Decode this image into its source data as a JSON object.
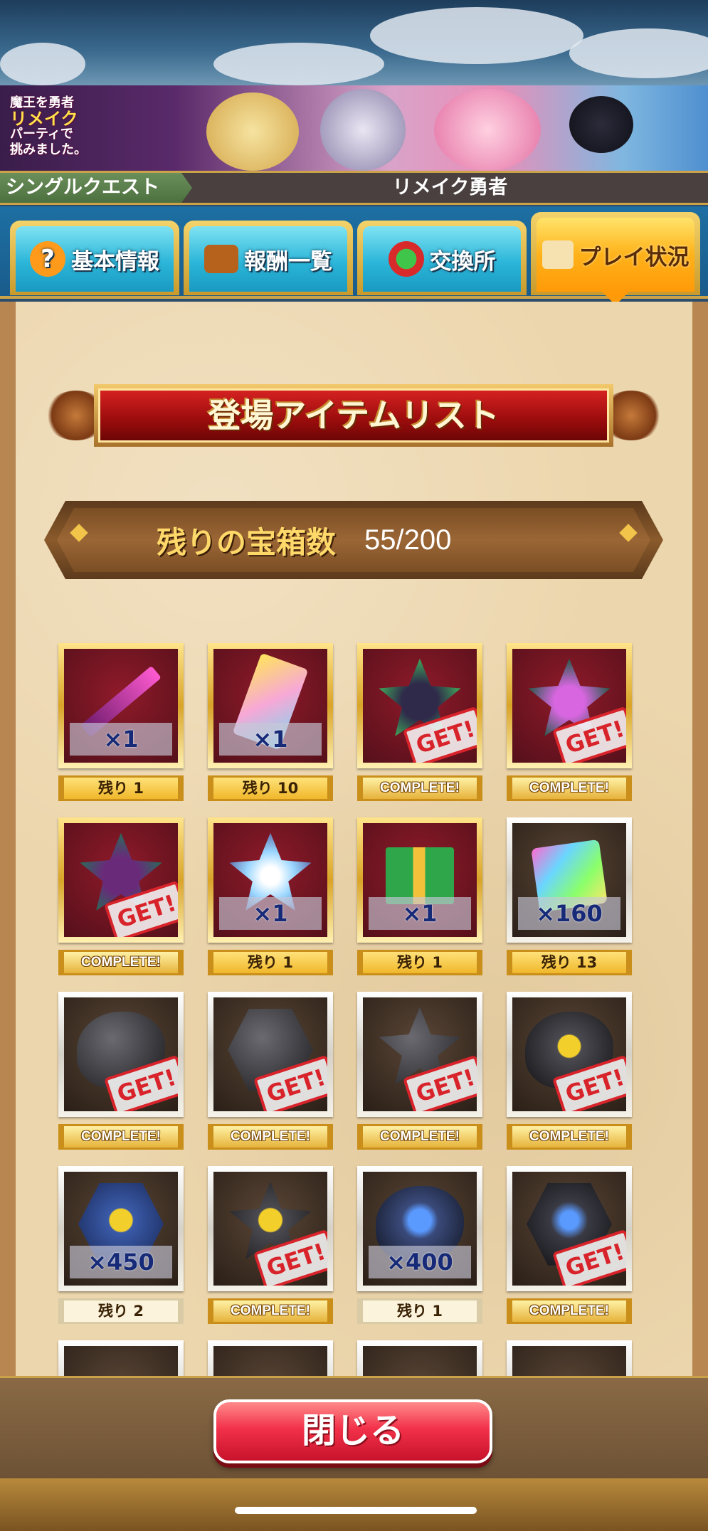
{
  "banner": {
    "line1": "魔王を勇者",
    "line2": "リメイク",
    "line3": "パーティで",
    "line4": "挑みました。"
  },
  "quest": {
    "type": "シングルクエスト",
    "name": "リメイク勇者"
  },
  "tabs": [
    {
      "label": "基本情報",
      "icon": "question-icon"
    },
    {
      "label": "報酬一覧",
      "icon": "treasure-chest-icon"
    },
    {
      "label": "交換所",
      "icon": "exchange-icon"
    },
    {
      "label": "プレイ状況",
      "icon": "scroll-icon",
      "active": true
    }
  ],
  "item_list_title": "登場アイテムリスト",
  "remaining": {
    "label": "残りの宝箱数",
    "value": "55/200"
  },
  "items": [
    {
      "name": "dark-sword",
      "qty": "×1",
      "status": "残り 1",
      "complete": false
    },
    {
      "name": "ticket",
      "qty": "×1",
      "status": "残り 10",
      "complete": false
    },
    {
      "name": "green-star-crystal",
      "qty": "",
      "status": "COMPLETE!",
      "complete": true
    },
    {
      "name": "purple-star-crystal",
      "qty": "",
      "status": "COMPLETE!",
      "complete": true
    },
    {
      "name": "dark-star-weapon",
      "qty": "",
      "status": "COMPLETE!",
      "complete": true
    },
    {
      "name": "rainbow-star-orb",
      "qty": "×1",
      "status": "残り 1",
      "complete": false
    },
    {
      "name": "gift-box",
      "qty": "×1",
      "status": "残り 1",
      "complete": false
    },
    {
      "name": "rainbow-card",
      "qty": "×160",
      "status": "残り 13",
      "complete": false
    },
    {
      "name": "black-blob-red-sword",
      "qty": "",
      "status": "COMPLETE!",
      "complete": true
    },
    {
      "name": "black-hex-red-sword",
      "qty": "",
      "status": "COMPLETE!",
      "complete": true
    },
    {
      "name": "black-star-red-sword",
      "qty": "",
      "status": "COMPLETE!",
      "complete": true
    },
    {
      "name": "black-blob-yellow-fist",
      "qty": "",
      "status": "COMPLETE!",
      "complete": true
    },
    {
      "name": "blue-hex-yellow-fist",
      "qty": "×450",
      "status": "残り 2",
      "complete": false
    },
    {
      "name": "black-star-yellow-fist",
      "qty": "",
      "status": "COMPLETE!",
      "complete": true
    },
    {
      "name": "blue-blob-axe",
      "qty": "×400",
      "status": "残り 1",
      "complete": false
    },
    {
      "name": "black-hex-axe",
      "qty": "",
      "status": "COMPLETE!",
      "complete": true
    }
  ],
  "get_stamp": "GET!",
  "close_label": "閉じる",
  "colors": {
    "accent_gold": "#d9a428",
    "title_red": "#c21616",
    "close_red": "#f2314a",
    "tab_blue": "#2cb6d9",
    "tab_active": "#ffb21a"
  }
}
